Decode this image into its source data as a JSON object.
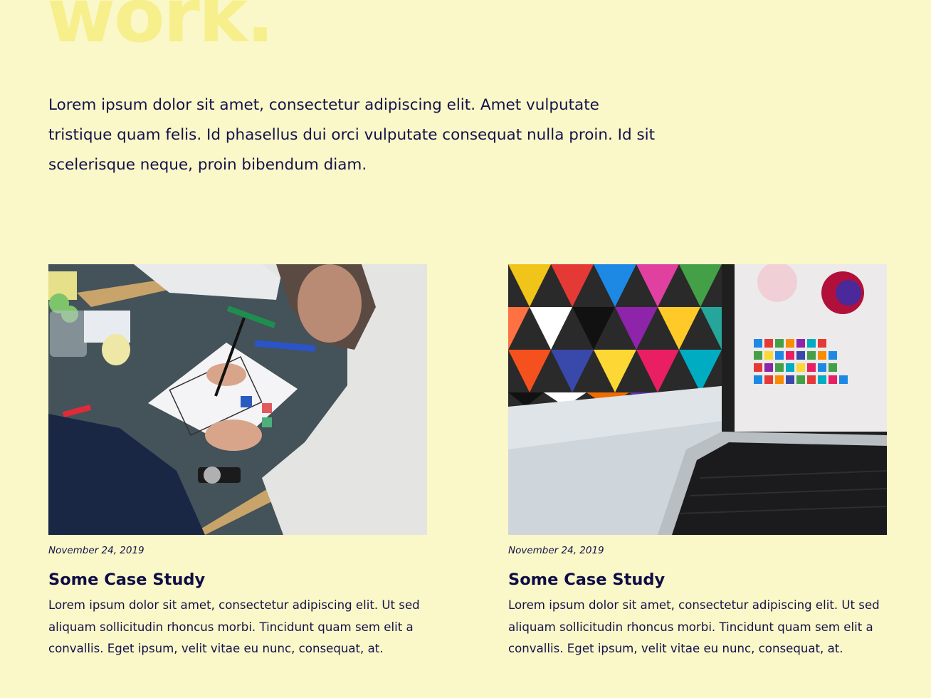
{
  "hero": {
    "word": "work."
  },
  "intro": {
    "text": "Lorem ipsum dolor sit amet, consectetur adipiscing elit. Amet vulputate tristique quam felis. Id phasellus dui orci vulputate consequat nulla proin. Id sit scelerisque neque, proin bibendum diam."
  },
  "colors": {
    "background": "#faf7c8",
    "hero_accent": "#f6ef8c",
    "text": "#14124a"
  },
  "cards": [
    {
      "image": "photo-sketching-app-wireframe",
      "date": "November 24, 2019",
      "title": "Some Case Study",
      "excerpt": "Lorem ipsum dolor sit amet, consectetur adipiscing elit. Ut sed aliquam sollicitudin rhoncus morbi. Tincidunt quam sem elit a convallis. Eget ipsum, velit vitae eu nunc, consequat, at."
    },
    {
      "image": "photo-laptop-colorful-design",
      "date": "November 24, 2019",
      "title": "Some Case Study",
      "excerpt": "Lorem ipsum dolor sit amet, consectetur adipiscing elit. Ut sed aliquam sollicitudin rhoncus morbi. Tincidunt quam sem elit a convallis. Eget ipsum, velit vitae eu nunc, consequat, at."
    }
  ]
}
